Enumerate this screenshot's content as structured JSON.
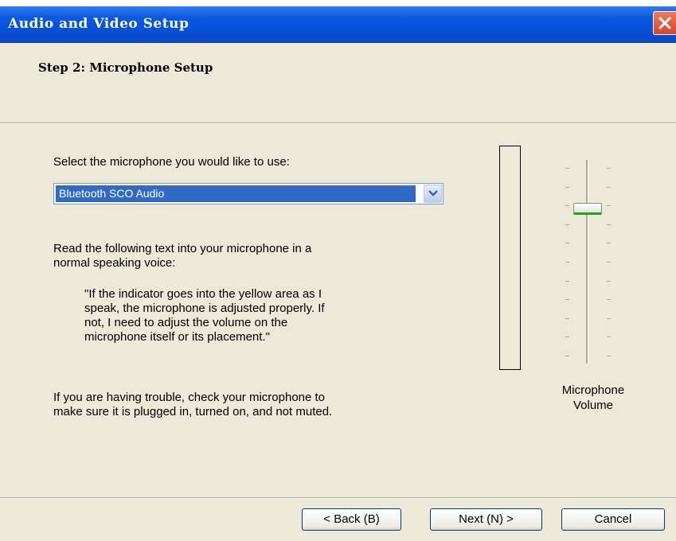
{
  "window": {
    "title": "Audio and Video Setup"
  },
  "header": {
    "step_title": "Step 2: Microphone Setup"
  },
  "content": {
    "select_prompt": "Select the microphone you would like to use:",
    "microphone_selected": "Bluetooth SCO Audio",
    "read_instruction_line1": "Read the following text into your microphone in a",
    "read_instruction_line2": "normal speaking voice:",
    "quote_line1": "\"If the indicator goes into the yellow area as I",
    "quote_line2": "speak, the microphone is adjusted properly.  If",
    "quote_line3": "not, I need to adjust the volume on the",
    "quote_line4": "microphone itself or its placement.\"",
    "trouble_line1": "If you are having trouble, check your microphone to",
    "trouble_line2": "make sure it is plugged in, turned on, and not muted."
  },
  "volume": {
    "label_line1": "Microphone",
    "label_line2": "Volume",
    "level_fraction": 0.75,
    "meter_level_fraction": 0
  },
  "buttons": {
    "back": "< Back (B)",
    "next": "Next (N) >",
    "cancel": "Cancel"
  },
  "icons": {
    "close": "close-x-icon",
    "dropdown": "chevron-down-icon"
  },
  "colors": {
    "titlebar": "#0550d6",
    "dialog_bg": "#ece9d8",
    "selection": "#316ac5",
    "close_button": "#d6452a",
    "slider_thumb_accent": "#21a121"
  }
}
